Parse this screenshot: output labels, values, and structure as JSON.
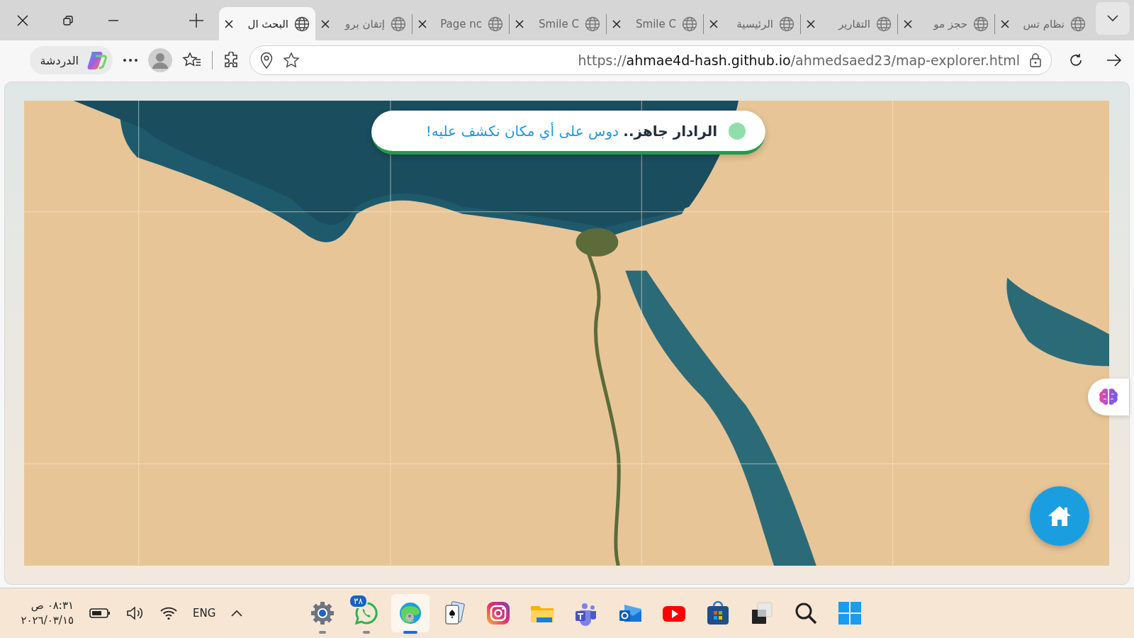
{
  "tabs": [
    {
      "title": "نظام تس",
      "selected": false
    },
    {
      "title": "حجز مو",
      "selected": false
    },
    {
      "title": "التقارير",
      "selected": false
    },
    {
      "title": "الرئيسية",
      "selected": false
    },
    {
      "title": "Smile C",
      "selected": false
    },
    {
      "title": "Smile C",
      "selected": false
    },
    {
      "title": "Page nc",
      "selected": false
    },
    {
      "title": "إتقان برو",
      "selected": false
    },
    {
      "title": "البحث ال",
      "selected": true
    }
  ],
  "address_bar": {
    "scheme": "https://",
    "host": "ahmae4d-hash.github.io",
    "path": "/ahmedsaed23/map-explorer.html"
  },
  "copilot": {
    "label": "الدردشة"
  },
  "status": {
    "lead": "الرادار جاهز..",
    "message": "دوس على أي مكان نكشف عليه!",
    "ready": true
  },
  "taskbar": {
    "time": "٠٨:٣١ ص",
    "date": "٢٠٢٦/٠٣/١٥",
    "language": "ENG",
    "apps": [
      {
        "kind": "settings",
        "running": true,
        "selected": false
      },
      {
        "kind": "chat",
        "running": true,
        "selected": false,
        "badge": "٣٨"
      },
      {
        "kind": "browser",
        "running": true,
        "selected": true
      },
      {
        "kind": "cards",
        "running": false,
        "selected": false
      },
      {
        "kind": "camera",
        "running": false,
        "selected": false
      },
      {
        "kind": "folder",
        "running": false,
        "selected": false
      },
      {
        "kind": "people",
        "running": false,
        "selected": false
      },
      {
        "kind": "mail",
        "running": false,
        "selected": false
      },
      {
        "kind": "video",
        "running": false,
        "selected": false
      },
      {
        "kind": "store",
        "running": false,
        "selected": false
      },
      {
        "kind": "windows",
        "running": false,
        "selected": false
      },
      {
        "kind": "search",
        "running": false,
        "selected": false
      },
      {
        "kind": "start",
        "running": false,
        "selected": false
      }
    ]
  }
}
